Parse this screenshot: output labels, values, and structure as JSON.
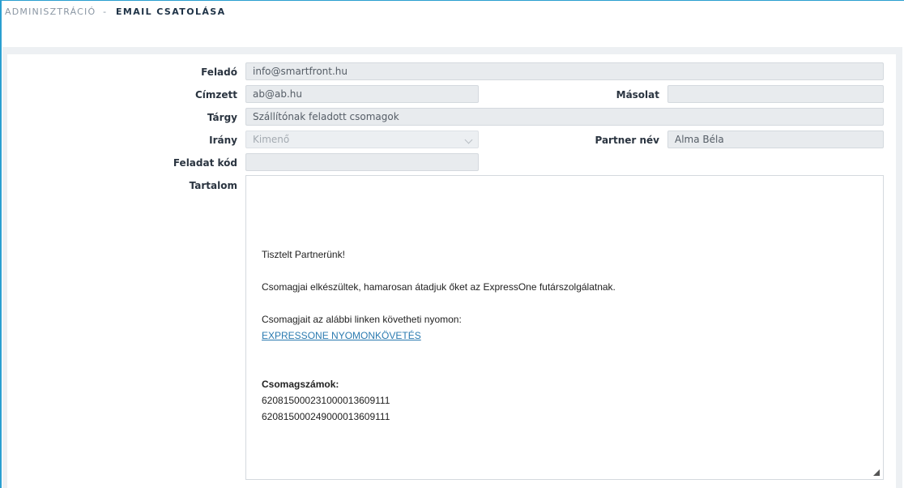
{
  "breadcrumb": {
    "parent": "ADMINISZTRÁCIÓ",
    "separator": "-",
    "current": "EMAIL CSATOLÁSA"
  },
  "form": {
    "sender": {
      "label": "Feladó",
      "value": "info@smartfront.hu"
    },
    "recipient": {
      "label": "Címzett",
      "value": "ab@ab.hu"
    },
    "cc": {
      "label": "Másolat",
      "value": ""
    },
    "subject": {
      "label": "Tárgy",
      "value": "Szállítónak feladott csomagok"
    },
    "direction": {
      "label": "Irány",
      "value": "Kimenő"
    },
    "partner_name": {
      "label": "Partner név",
      "value": "Alma Béla"
    },
    "task_code": {
      "label": "Feladat kód",
      "value": ""
    },
    "content_label": "Tartalom"
  },
  "content": {
    "greeting": "Tisztelt Partnerünk!",
    "line1": "Csomagjai elkészültek, hamarosan átadjuk őket az ExpressOne futárszolgálatnak.",
    "line2": "Csomagjait az alábbi linken követheti nyomon:",
    "link_text": "EXPRESSONE NYOMONKÖVETÉS",
    "packages_title": "Csomagszámok:",
    "package_numbers": [
      "62081500023100001360911​1",
      "620815000249000013609111"
    ]
  },
  "colors": {
    "accent": "#2a9fd0",
    "label": "#2a3440",
    "field_bg": "#e8ebee",
    "link": "#2a7ab0"
  }
}
